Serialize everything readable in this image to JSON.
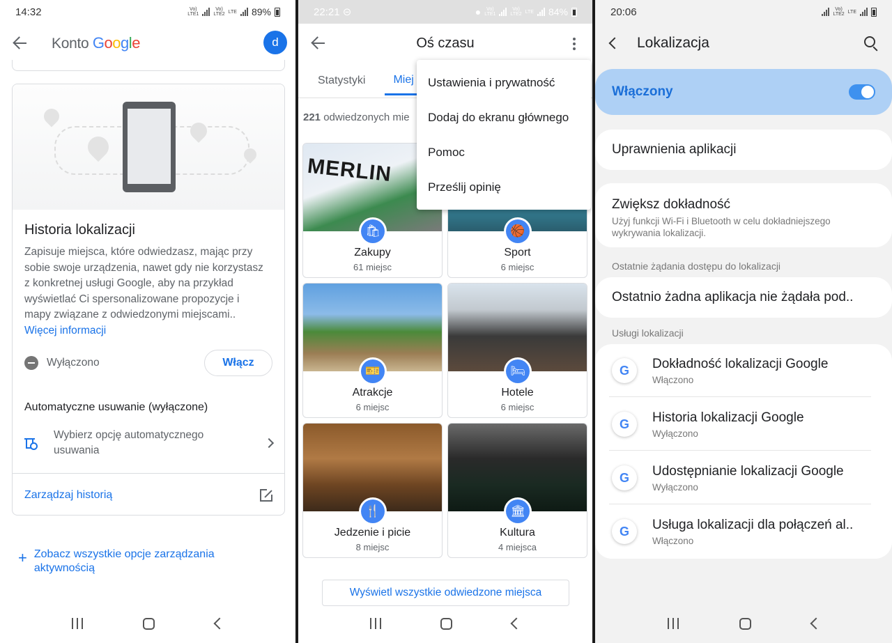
{
  "p1": {
    "status": {
      "time": "14:32",
      "net1": "Vo)\nLTE1",
      "net2": "Vo)\nLTE2",
      "lte": "LTE",
      "battery": "89%"
    },
    "header": {
      "prefix": "Konto ",
      "g1": "G",
      "g2": "o",
      "g3": "o",
      "g4": "g",
      "g5": "l",
      "g6": "e",
      "avatar": "d"
    },
    "history": {
      "title": "Historia lokalizacji",
      "desc": "Zapisuje miejsca, które odwiedzasz, mając przy sobie swoje urządzenia, nawet gdy nie korzystasz z konkretnej usługi Google, aby na przykład wyświetlać Ci spersonalizowane propozycje i mapy związane z odwiedzonymi miejscami.. ",
      "more": "Więcej informacji",
      "status": "Wyłączono",
      "enable_btn": "Włącz",
      "auto_title": "Automatyczne usuwanie (wyłączone)",
      "auto_text": "Wybierz opcję automatycznego usuwania",
      "manage": "Zarządzaj historią"
    },
    "see_all": "Zobacz wszystkie opcje zarządzania aktywnością"
  },
  "p2": {
    "status": {
      "time": "22:21",
      "net1": "Vo)\nLTE1",
      "net2": "Vo)\nLTE2",
      "lte": "LTE",
      "battery": "84%"
    },
    "title": "Oś czasu",
    "tabs": [
      "Statystyki",
      "Miej"
    ],
    "visited_count": "221",
    "visited_text": " odwiedzonych mie",
    "places": [
      {
        "name": "Zakupy",
        "count": "61 miejsc",
        "icon": "🛍",
        "sign": "MERLIN"
      },
      {
        "name": "Sport",
        "count": "6 miejsc",
        "icon": "🏀"
      },
      {
        "name": "Atrakcje",
        "count": "6 miejsc",
        "icon": "🎫"
      },
      {
        "name": "Hotele",
        "count": "6 miejsc",
        "icon": "🛏"
      },
      {
        "name": "Jedzenie i picie",
        "count": "8 miejsc",
        "icon": "🍴"
      },
      {
        "name": "Kultura",
        "count": "4 miejsca",
        "icon": "🏛"
      }
    ],
    "show_all": "Wyświetl wszystkie odwiedzone miejsca",
    "menu": [
      "Ustawienia i prywatność",
      "Dodaj do ekranu głównego",
      "Pomoc",
      "Prześlij opinię"
    ]
  },
  "p3": {
    "status": {
      "time": "20:06",
      "net": "Vo)\nLTE2",
      "lte": "LTE"
    },
    "title": "Lokalizacja",
    "on_label": "Włączony",
    "permissions": "Uprawnienia aplikacji",
    "accuracy_title": "Zwiększ dokładność",
    "accuracy_sub": "Użyj funkcji Wi-Fi i Bluetooth w celu dokładniejszego wykrywania lokalizacji.",
    "recent_label": "Ostatnie żądania dostępu do lokalizacji",
    "recent_text": "Ostatnio żadna aplikacja nie żądała pod..",
    "services_label": "Usługi lokalizacji",
    "services": [
      {
        "title": "Dokładność lokalizacji Google",
        "sub": "Włączono"
      },
      {
        "title": "Historia lokalizacji Google",
        "sub": "Wyłączono"
      },
      {
        "title": "Udostępnianie lokalizacji Google",
        "sub": "Wyłączono"
      },
      {
        "title": "Usługa lokalizacji dla połączeń al..",
        "sub": "Włączono"
      }
    ],
    "g_letter": "G"
  }
}
